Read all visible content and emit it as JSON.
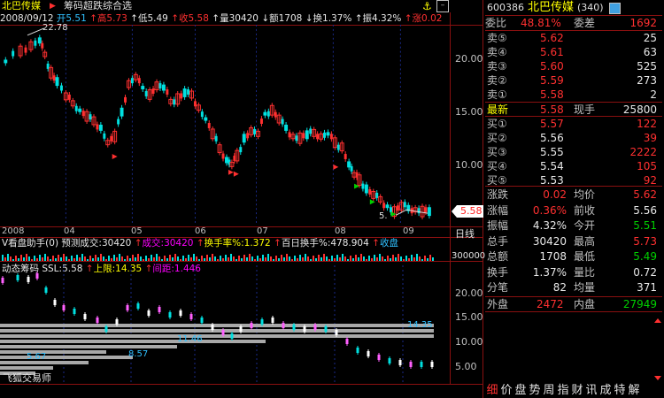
{
  "header": {
    "stock_name": "北巴传媒",
    "indicator_name": "筹码超跌综合选",
    "date": "2008/09/12",
    "open_label": "开",
    "open": "5.51",
    "high_label": "高",
    "high": "5.73",
    "low_label": "低",
    "low": "5.49",
    "close_label": "收",
    "close": "5.58",
    "vol_label": "量",
    "vol": "30420",
    "amt_label": "额",
    "amt": "1708",
    "turn_label": "换",
    "turn": "1.37%",
    "amp_label": "振",
    "amp": "4.32%",
    "chg_label": "涨",
    "chg": "0.02"
  },
  "main_chart": {
    "peak_label": "22.78",
    "low_label": "5.",
    "price_tag": "5.58",
    "y_ticks": [
      "20.00",
      "15.00",
      "10.00"
    ],
    "x_ticks": [
      "2008",
      "04",
      "05",
      "06",
      "07",
      "08",
      "09"
    ],
    "day_line_label": "日线"
  },
  "volume_bar": {
    "title": "V看盘助手(0)",
    "pred_label": "预测成交:",
    "pred_value": "30420",
    "vol_label": "成交:",
    "vol_value": "30420",
    "turn_label": "换手率%:",
    "turn_value": "1.372",
    "hundred_label": "百日换手%:",
    "hundred_value": "478.904",
    "buy_label": "收盘",
    "y_tick": "300000"
  },
  "chip_panel": {
    "title": "动态筹码",
    "ssl_label": "SSL:",
    "ssl_value": "5.58",
    "upper_label": "上限:",
    "upper_value": "14.35",
    "gap_label": "间距:",
    "gap_value": "1.446",
    "bar_labels": [
      "14.35",
      "11.46",
      "8.57",
      "5.67"
    ],
    "y_ticks": [
      "20.00",
      "15.00",
      "10.00",
      "5.00"
    ],
    "watermark": "飞狐交易师"
  },
  "quote_panel": {
    "code": "600386",
    "name": "北巴传媒",
    "count": "(340)",
    "ratio_label": "委比",
    "ratio": "48.81%",
    "diff_label": "委差",
    "diff": "1692",
    "sells": [
      {
        "label": "卖⑤",
        "price": "5.62",
        "vol": "25"
      },
      {
        "label": "卖④",
        "price": "5.61",
        "vol": "63"
      },
      {
        "label": "卖③",
        "price": "5.60",
        "vol": "525"
      },
      {
        "label": "卖②",
        "price": "5.59",
        "vol": "273"
      },
      {
        "label": "卖①",
        "price": "5.58",
        "vol": "2"
      }
    ],
    "last_label": "最新",
    "last": "5.58",
    "now_label": "现手",
    "now": "25800",
    "buys": [
      {
        "label": "买①",
        "price": "5.57",
        "vol": "122"
      },
      {
        "label": "买②",
        "price": "5.56",
        "vol": "39"
      },
      {
        "label": "买③",
        "price": "5.55",
        "vol": "2222"
      },
      {
        "label": "买④",
        "price": "5.54",
        "vol": "105"
      },
      {
        "label": "买⑤",
        "price": "5.53",
        "vol": "92"
      }
    ],
    "stats": [
      {
        "l1": "涨跌",
        "v1": "0.02",
        "c1": "r",
        "l2": "均价",
        "v2": "5.62",
        "c2": "r"
      },
      {
        "l1": "涨幅",
        "v1": "0.36%",
        "c1": "r",
        "l2": "前收",
        "v2": "5.56",
        "c2": "w"
      },
      {
        "l1": "振幅",
        "v1": "4.32%",
        "c1": "w",
        "l2": "今开",
        "v2": "5.51",
        "c2": "g"
      },
      {
        "l1": "总手",
        "v1": "30420",
        "c1": "w",
        "l2": "最高",
        "v2": "5.73",
        "c2": "r"
      },
      {
        "l1": "总额",
        "v1": "1708",
        "c1": "w",
        "l2": "最低",
        "v2": "5.49",
        "c2": "g"
      },
      {
        "l1": "换手",
        "v1": "1.37%",
        "c1": "w",
        "l2": "量比",
        "v2": "0.72",
        "c2": "w"
      },
      {
        "l1": "分笔",
        "v1": "82",
        "c1": "w",
        "l2": "均量",
        "v2": "371",
        "c2": "w"
      }
    ],
    "outer_label": "外盘",
    "outer": "2472",
    "inner_label": "内盘",
    "inner": "27949"
  },
  "tabs": [
    "细",
    "价",
    "盘",
    "势",
    "周",
    "指",
    "财",
    "讯",
    "成",
    "特",
    "解"
  ],
  "colors": {
    "up": "#ff3030",
    "down": "#00e0e0",
    "frame": "#8a1010",
    "yellow": "#ffff00"
  }
}
